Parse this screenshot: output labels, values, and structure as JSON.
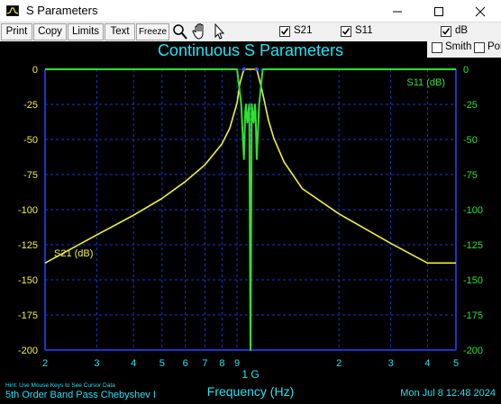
{
  "window": {
    "title": "S Parameters"
  },
  "toolbar": {
    "print_label": "Print",
    "copy_label": "Copy",
    "limits_label": "Limits",
    "text_label": "Text",
    "freeze_label": "Freeze",
    "s21_label": "S21",
    "s21_checked": true,
    "s11_label": "S11",
    "s11_checked": true,
    "db_label": "dB",
    "db_checked": true,
    "smith_label": "Smith",
    "smith_checked": false,
    "polar_label": "Pol",
    "polar_checked": false
  },
  "footer": {
    "hint": "Hint: Use Mouse Keys to See Cursor Data",
    "subtitle": "5th Order Band Pass Chebyshev I",
    "timestamp": "Mon Jul  8 12:48 2024"
  },
  "colors": {
    "background": "#000000",
    "grid": "#1e32c8",
    "axis": "#1e32c8",
    "text": "#28e0f0",
    "s21": "#f0f040",
    "s11": "#30e030",
    "y_tick_left": "#f0f040",
    "y_tick_right": "#30e030"
  },
  "chart_data": {
    "type": "line",
    "title": "Continuous S Parameters",
    "xlabel": "Frequency (Hz)",
    "x_scale": "log",
    "x_center_label": "1 G",
    "x_ticks_left": [
      "2",
      "3",
      "4",
      "5",
      "6",
      "7",
      "8",
      "9"
    ],
    "x_ticks_right": [
      "2",
      "3",
      "4",
      "5"
    ],
    "x_range_ghz": [
      0.2,
      5
    ],
    "y_range_db": [
      -200,
      0
    ],
    "y_ticks": [
      "0",
      "-25",
      "-50",
      "-75",
      "-100",
      "-125",
      "-150",
      "-175",
      "-200"
    ],
    "grid": true,
    "series": [
      {
        "name": "S21 (dB)",
        "color": "#f0f040",
        "x_ghz": [
          0.2,
          0.3,
          0.4,
          0.5,
          0.6,
          0.7,
          0.8,
          0.85,
          0.9,
          0.92,
          0.95,
          1.0,
          1.05,
          1.08,
          1.1,
          1.15,
          1.2,
          1.3,
          1.5,
          2.0,
          3.0,
          4.0,
          5.0
        ],
        "y_db": [
          -138,
          -118,
          -104,
          -92,
          -80,
          -68,
          -53,
          -42,
          -24,
          -10,
          0,
          0,
          0,
          -10,
          -17,
          -36,
          -49,
          -66,
          -85,
          -103,
          -124,
          -138,
          -138
        ]
      },
      {
        "name": "S11 (dB)",
        "color": "#30e030",
        "x_ghz": [
          0.2,
          0.9,
          0.93,
          0.95,
          0.96,
          0.965,
          0.975,
          0.99,
          1.0,
          1.01,
          1.025,
          1.035,
          1.04,
          1.05,
          1.07,
          1.1,
          5.0
        ],
        "y_db": [
          0,
          0,
          -25,
          -64,
          -30,
          -25,
          -38,
          -25,
          -200,
          -25,
          -38,
          -25,
          -30,
          -64,
          -25,
          0,
          0
        ]
      }
    ]
  }
}
